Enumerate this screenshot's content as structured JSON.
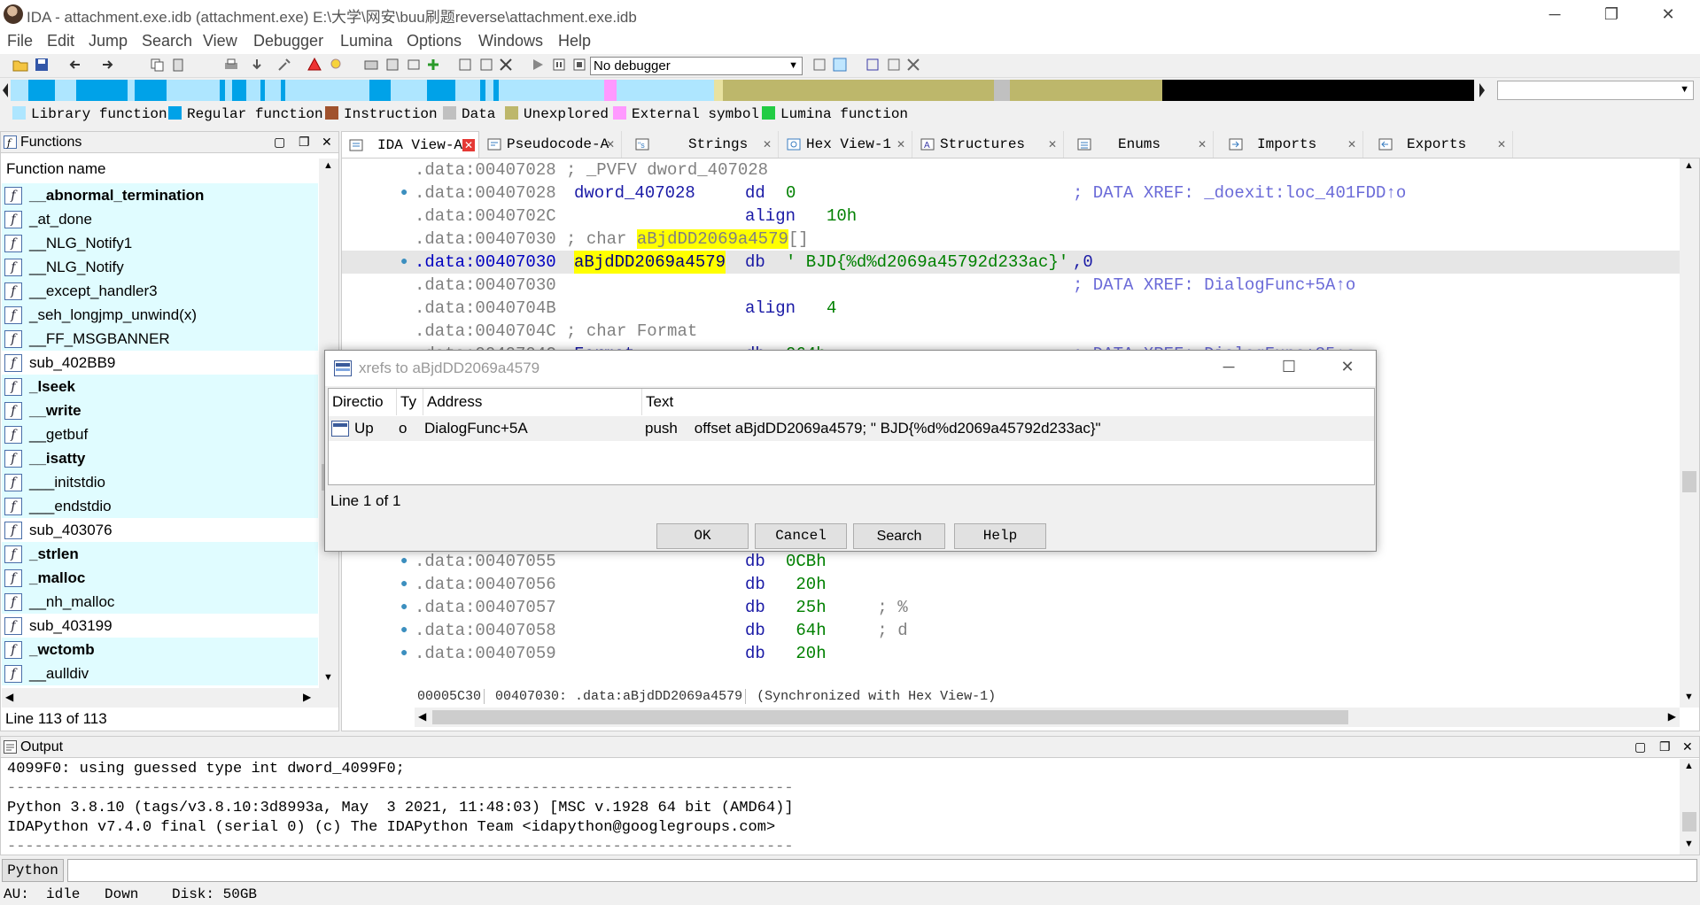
{
  "window": {
    "title": "IDA - attachment.exe.idb (attachment.exe) E:\\大学\\网安\\buu刷题reverse\\attachment.exe.idb",
    "minimize": "─",
    "maximize": "❐",
    "close": "✕"
  },
  "menu": [
    "File",
    "Edit",
    "Jump",
    "Search",
    "View",
    "Debugger",
    "Lumina",
    "Options",
    "Windows",
    "Help"
  ],
  "toolbar": {
    "debugger_select": "No debugger"
  },
  "legend": [
    {
      "label": "Library function",
      "color": "#aee6ff"
    },
    {
      "label": "Regular function",
      "color": "#00a2e8"
    },
    {
      "label": "Instruction",
      "color": "#a0522d"
    },
    {
      "label": "Data",
      "color": "#c0c0c0"
    },
    {
      "label": "Unexplored",
      "color": "#bdb76b"
    },
    {
      "label": "External symbol",
      "color": "#ff99ff"
    },
    {
      "label": "Lumina function",
      "color": "#22cc44"
    }
  ],
  "functions_panel": {
    "title": "Functions",
    "column": "Function name",
    "items": [
      {
        "name": "__abnormal_termination",
        "lib": true,
        "bold": true
      },
      {
        "name": "_at_done",
        "lib": true,
        "bold": false
      },
      {
        "name": "__NLG_Notify1",
        "lib": true,
        "bold": false
      },
      {
        "name": "__NLG_Notify",
        "lib": true,
        "bold": false
      },
      {
        "name": "__except_handler3",
        "lib": true,
        "bold": false
      },
      {
        "name": "_seh_longjmp_unwind(x)",
        "lib": true,
        "bold": false
      },
      {
        "name": "__FF_MSGBANNER",
        "lib": true,
        "bold": false
      },
      {
        "name": "sub_402BB9",
        "lib": false,
        "bold": false
      },
      {
        "name": "_lseek",
        "lib": true,
        "bold": true
      },
      {
        "name": "__write",
        "lib": true,
        "bold": true
      },
      {
        "name": "__getbuf",
        "lib": true,
        "bold": false
      },
      {
        "name": "__isatty",
        "lib": true,
        "bold": true
      },
      {
        "name": "___initstdio",
        "lib": true,
        "bold": false
      },
      {
        "name": "___endstdio",
        "lib": true,
        "bold": false
      },
      {
        "name": "sub_403076",
        "lib": false,
        "bold": false
      },
      {
        "name": "_strlen",
        "lib": true,
        "bold": true
      },
      {
        "name": "_malloc",
        "lib": true,
        "bold": true
      },
      {
        "name": "__nh_malloc",
        "lib": true,
        "bold": false
      },
      {
        "name": "sub_403199",
        "lib": false,
        "bold": false
      },
      {
        "name": "_wctomb",
        "lib": true,
        "bold": true
      },
      {
        "name": "__aulldiv",
        "lib": true,
        "bold": false
      }
    ],
    "status": "Line 113 of 113"
  },
  "tabs": [
    {
      "label": "IDA View-A",
      "active": true
    },
    {
      "label": "Pseudocode-A",
      "active": false
    },
    {
      "label": "Strings",
      "active": false
    },
    {
      "label": "Hex View-1",
      "active": false
    },
    {
      "label": "Structures",
      "active": false
    },
    {
      "label": "Enums",
      "active": false
    },
    {
      "label": "Imports",
      "active": false
    },
    {
      "label": "Exports",
      "active": false
    }
  ],
  "code_lines": {
    "l0": {
      "addr": ".data:00407028",
      "rest": " ; _PVFV dword_407028"
    },
    "l1": {
      "addr": ".data:00407028",
      "name": "dword_407028",
      "op": "dd",
      "val": "0",
      "xref": "; DATA XREF: _doexit:loc_401FDD↑o"
    },
    "l2": {
      "addr": ".data:0040702C",
      "op": "align",
      "val": "10h"
    },
    "l3": {
      "addr": ".data:00407030",
      "pre": " ; char ",
      "hl": "aBjdDD2069a4579",
      "post": "[]"
    },
    "l4": {
      "addr": ".data:00407030",
      "name": "aBjdDD2069a4579",
      "op": "db",
      "str": "' BJD{%d%d2069a45792d233ac}'",
      "tail": ",0"
    },
    "l5": {
      "addr": ".data:00407030",
      "xref": "; DATA XREF: DialogFunc+5A↑o"
    },
    "l6": {
      "addr": ".data:0040704B",
      "op": "align",
      "val": "4"
    },
    "l7": {
      "addr": ".data:0040704C",
      "rest": " ; char Format"
    },
    "l8": {
      "addr": ".data:0040704C",
      "name": "Format",
      "op": "db",
      "val": "064h",
      "xref": "; DATA XREF: DialogFunc+35↑o"
    },
    "l9": {
      "addr": ".data:00407055",
      "op": "db",
      "val": "0CBh"
    },
    "l10": {
      "addr": ".data:00407056",
      "op": "db",
      "val": " 20h"
    },
    "l11": {
      "addr": ".data:00407057",
      "op": "db",
      "val": " 25h",
      "cmt": " ; %"
    },
    "l12": {
      "addr": ".data:00407058",
      "op": "db",
      "val": " 64h",
      "cmt": " ; d"
    },
    "l13": {
      "addr": ".data:00407059",
      "op": "db",
      "val": " 20h"
    }
  },
  "code_status": {
    "offset": "00005C30",
    "location": "00407030: .data:aBjdDD2069a4579",
    "sync": "(Synchronized with Hex View-1)"
  },
  "xrefs_dialog": {
    "title": "xrefs to aBjdDD2069a4579",
    "columns": [
      "Directio",
      "Ty",
      "Address",
      "Text"
    ],
    "row": {
      "direction": "Up",
      "type": "o",
      "address": "DialogFunc+5A",
      "text": "push    offset aBjdDD2069a4579; \" BJD{%d%d2069a45792d233ac}\""
    },
    "line_count": "Line 1 of 1",
    "buttons": {
      "ok": "OK",
      "cancel": "Cancel",
      "search": "Search",
      "help": "Help"
    }
  },
  "output_panel": {
    "title": "Output",
    "lines": [
      "4099F0: using guessed type int dword_4099F0;",
      "---------------------------------------------------------------------------------------",
      "Python 3.8.10 (tags/v3.8.10:3d8993a, May  3 2021, 11:48:03) [MSC v.1928 64 bit (AMD64)]",
      "IDAPython v7.4.0 final (serial 0) (c) The IDAPython Team <idapython@googlegroups.com>",
      "---------------------------------------------------------------------------------------"
    ]
  },
  "python_bar": {
    "button": "Python",
    "input_value": ""
  },
  "statusbar": {
    "au": "AU:",
    "state": "idle",
    "direction": "Down",
    "disk": "Disk: 50GB"
  }
}
